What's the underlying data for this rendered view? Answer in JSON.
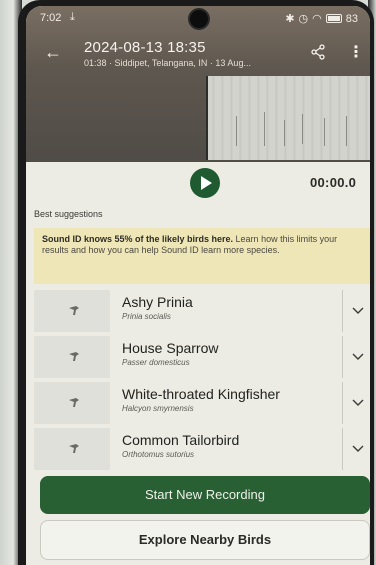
{
  "status_bar": {
    "time": "7:02",
    "download_glyph": "⤓",
    "battery_label": "83",
    "icons": [
      "bluetooth-icon",
      "alarm-icon",
      "wifi-icon",
      "battery-icon"
    ]
  },
  "header": {
    "title": "2024-08-13 18:35",
    "subtitle": "01:38 · Siddipet, Telangana, IN · 13 Aug..."
  },
  "player": {
    "timecode": "00:00.0"
  },
  "suggestions_label": "Best suggestions",
  "banner": {
    "bold_text": "Sound ID knows 55% of the likely birds here.",
    "rest_text": " Learn how this limits your results and how you can help Sound ID learn more species."
  },
  "birds": [
    {
      "common": "Ashy Prinia",
      "scientific": "Prinia socialis"
    },
    {
      "common": "House Sparrow",
      "scientific": "Passer domesticus"
    },
    {
      "common": "White-throated Kingfisher",
      "scientific": "Halcyon smyrnensis"
    },
    {
      "common": "Common Tailorbird",
      "scientific": "Orthotomus sutorius"
    }
  ],
  "buttons": {
    "start_recording": "Start New Recording",
    "explore": "Explore Nearby Birds"
  },
  "colors": {
    "accent_green": "#285f33",
    "banner_yellow": "#efe6b7"
  }
}
